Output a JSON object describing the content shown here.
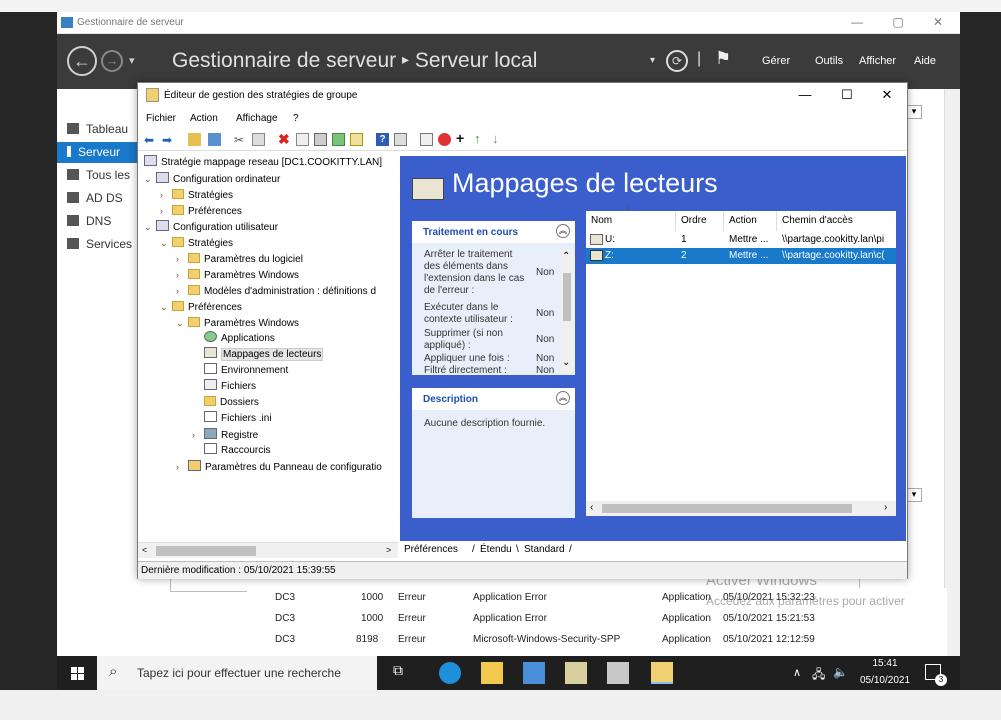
{
  "server_manager": {
    "title": "Gestionnaire de serveur",
    "breadcrumb_root": "Gestionnaire de serveur",
    "breadcrumb_sep": "▸",
    "breadcrumb_current": "Serveur local",
    "menus": [
      "Gérer",
      "Outils",
      "Afficher",
      "Aide"
    ],
    "nav": [
      "Tableau",
      "Serveur",
      "Tous les",
      "AD DS",
      "DNS",
      "Services"
    ],
    "events": [
      {
        "server": "DC3",
        "id": "1000",
        "level": "Erreur",
        "source": "Application Error",
        "log": "Application",
        "date": "05/10/2021 15:32:23"
      },
      {
        "server": "DC3",
        "id": "1000",
        "level": "Erreur",
        "source": "Application Error",
        "log": "Application",
        "date": "05/10/2021 15:21:53"
      },
      {
        "server": "DC3",
        "id": "8198",
        "level": "Erreur",
        "source": "Microsoft-Windows-Security-SPP",
        "log": "Application",
        "date": "05/10/2021 12:12:59"
      }
    ]
  },
  "gpe": {
    "title": "Éditeur de gestion des stratégies de groupe",
    "menu": [
      "Fichier",
      "Action",
      "Affichage",
      "?"
    ],
    "tree": {
      "root": "Stratégie mappage reseau [DC1.COOKITTY.LAN]",
      "config_ordinateur": "Configuration ordinateur",
      "strategies1": "Stratégies",
      "preferences1": "Préférences",
      "config_utilisateur": "Configuration utilisateur",
      "strategies2": "Stratégies",
      "param_logiciel": "Paramètres du logiciel",
      "param_windows1": "Paramètres Windows",
      "modeles_admin": "Modèles d'administration : définitions d",
      "preferences2": "Préférences",
      "param_windows2": "Paramètres Windows",
      "applications": "Applications",
      "mappages": "Mappages de lecteurs",
      "environnement": "Environnement",
      "fichiers": "Fichiers",
      "dossiers": "Dossiers",
      "fichiers_ini": "Fichiers .ini",
      "registre": "Registre",
      "raccourcis": "Raccourcis",
      "param_panneau": "Paramètres du Panneau de configuratio"
    },
    "status": "Dernière modification : 05/10/2021 15:39:55",
    "heading": "Mappages de lecteurs",
    "processing": {
      "title": "Traitement en cours",
      "items": [
        {
          "label": "Arrêter le traitement des éléments dans l'extension dans le cas de l'erreur :",
          "value": "Non"
        },
        {
          "label": "Exécuter dans le contexte utilisateur :",
          "value": "Non"
        },
        {
          "label": "Supprimer (si non appliqué) :",
          "value": "Non"
        },
        {
          "label": "Appliquer une fois :",
          "value": "Non"
        },
        {
          "label": "Filtré directement :",
          "value": "Non"
        }
      ]
    },
    "description": {
      "title": "Description",
      "text": "Aucune description fournie."
    },
    "columns": [
      "Nom",
      "Ordre",
      "Action",
      "Chemin d'accès"
    ],
    "rows": [
      {
        "name": "U:",
        "order": "1",
        "action": "Mettre ...",
        "path": "\\\\partage.cookitty.lan\\pi"
      },
      {
        "name": "Z:",
        "order": "2",
        "action": "Mettre ...",
        "path": "\\\\partage.cookitty.lan\\c("
      }
    ],
    "tabs": [
      "Préférences",
      "Étendu",
      "Standard"
    ]
  },
  "watermark": {
    "line1": "Activer Windows",
    "line2": "Accédez aux paramètres pour activer"
  },
  "taskbar": {
    "search": "Tapez ici pour effectuer une recherche",
    "time": "15:41",
    "date": "05/10/2021",
    "badge": "3"
  }
}
